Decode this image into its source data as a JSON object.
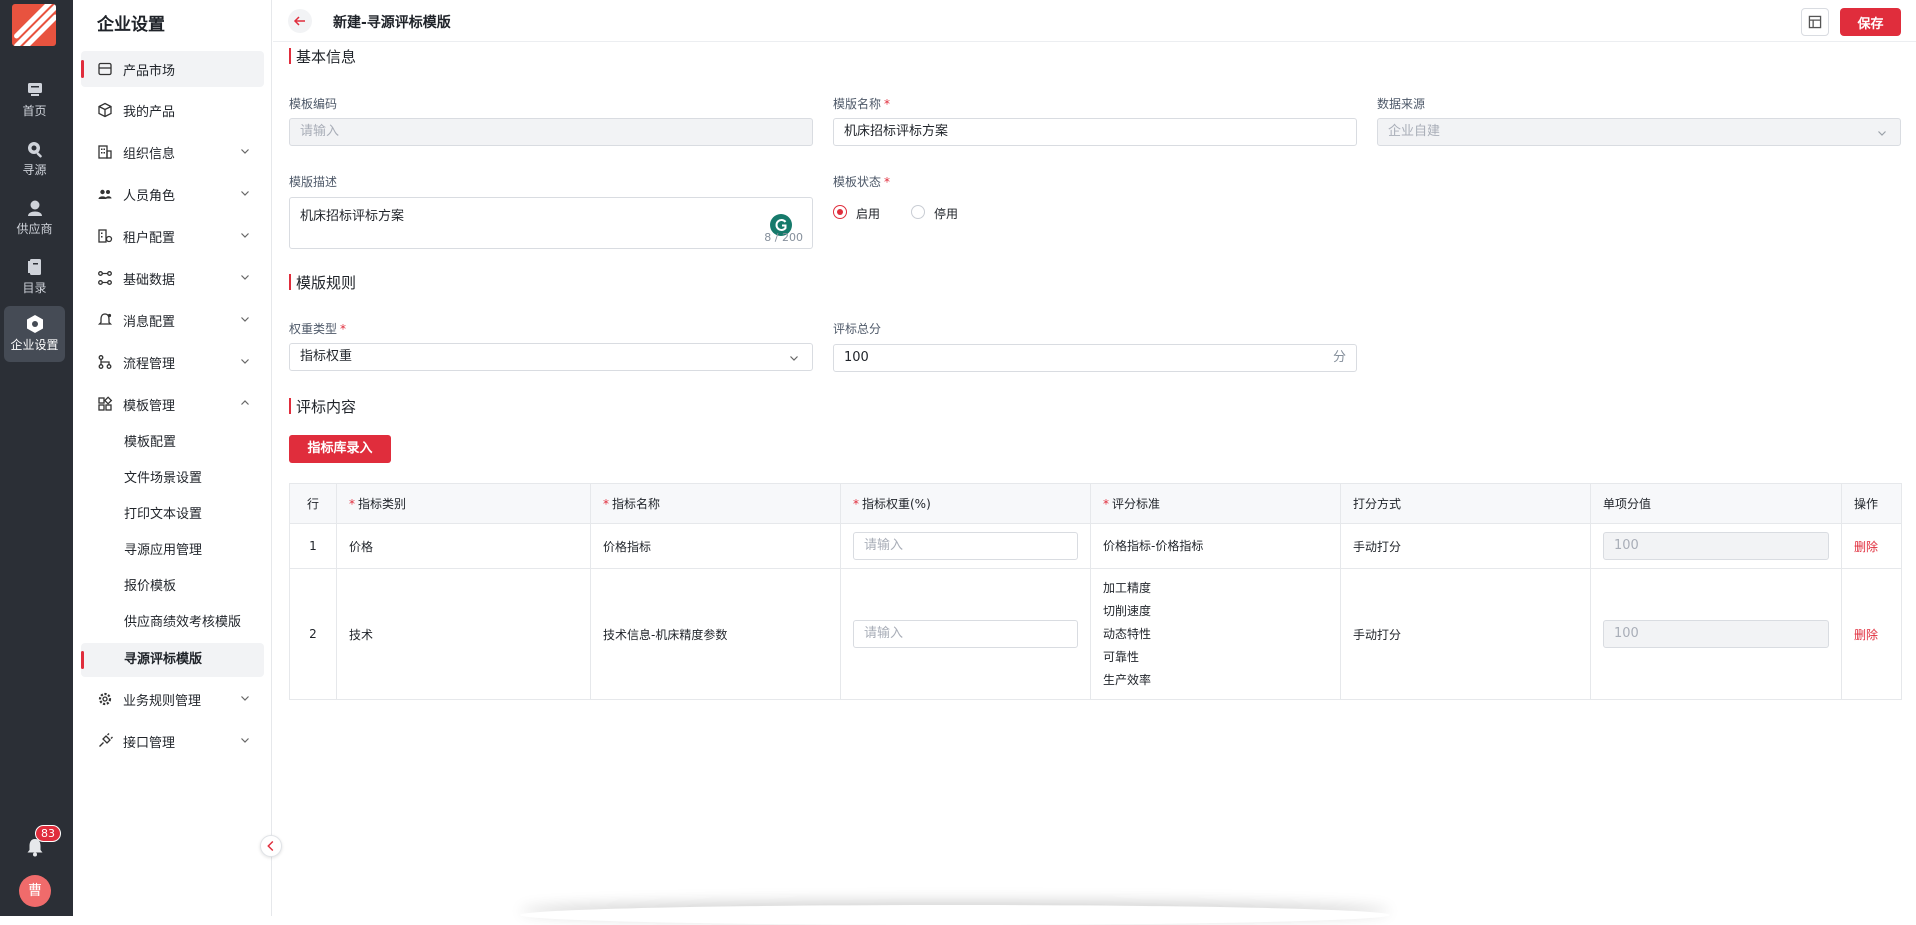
{
  "rail": {
    "items": [
      {
        "label": "首页",
        "icon": "home-icon"
      },
      {
        "label": "寻源",
        "icon": "sourcing-search-icon"
      },
      {
        "label": "供应商",
        "icon": "supplier-icon"
      },
      {
        "label": "目录",
        "icon": "catalog-icon"
      },
      {
        "label": "企业设置",
        "icon": "enterprise-settings-icon",
        "active": true
      }
    ],
    "notification_count": "83",
    "avatar_text": "曹"
  },
  "sidebar": {
    "title": "企业设置",
    "items": [
      {
        "label": "产品市场",
        "icon": "store-icon",
        "active": true
      },
      {
        "label": "我的产品",
        "icon": "cube-icon"
      },
      {
        "label": "组织信息",
        "icon": "building-icon",
        "expandable": true
      },
      {
        "label": "人员角色",
        "icon": "users-icon",
        "expandable": true
      },
      {
        "label": "租户配置",
        "icon": "tenant-icon",
        "expandable": true
      },
      {
        "label": "基础数据",
        "icon": "data-nodes-icon",
        "expandable": true
      },
      {
        "label": "消息配置",
        "icon": "message-bell-icon",
        "expandable": true
      },
      {
        "label": "流程管理",
        "icon": "flow-icon",
        "expandable": true
      },
      {
        "label": "模板管理",
        "icon": "template-grid-icon",
        "expanded": true
      }
    ],
    "sub_items": [
      {
        "label": "模板配置"
      },
      {
        "label": "文件场景设置"
      },
      {
        "label": "打印文本设置"
      },
      {
        "label": "寻源应用管理"
      },
      {
        "label": "报价模板"
      },
      {
        "label": "供应商绩效考核模版"
      },
      {
        "label": "寻源评标模版",
        "active": true
      }
    ],
    "items_after": [
      {
        "label": "业务规则管理",
        "icon": "gear-icon",
        "expandable": true
      },
      {
        "label": "接口管理",
        "icon": "plug-icon",
        "expandable": true
      }
    ]
  },
  "header": {
    "title": "新建-寻源评标模版",
    "save_label": "保存"
  },
  "basic_info": {
    "section_title": "基本信息",
    "code_label": "模板编码",
    "code_placeholder": "请输入",
    "name_label": "模版名称",
    "name_value": "机床招标评标方案",
    "source_label": "数据来源",
    "source_value": "企业自建",
    "desc_label": "模版描述",
    "desc_value": "机床招标评标方案",
    "desc_counter": "8 / 200",
    "status_label": "模板状态",
    "status_options": [
      "启用",
      "停用"
    ],
    "status_selected": "启用"
  },
  "rules": {
    "section_title": "模版规则",
    "weight_type_label": "权重类型",
    "weight_type_value": "指标权重",
    "total_score_label": "评标总分",
    "total_score_value": "100",
    "total_score_unit": "分"
  },
  "content": {
    "section_title": "评标内容",
    "import_button": "指标库录入",
    "columns": [
      "行",
      "指标类别",
      "指标名称",
      "指标权重(%)",
      "评分标准",
      "打分方式",
      "单项分值",
      "操作"
    ],
    "input_placeholder": "请输入",
    "rows": [
      {
        "row": "1",
        "category": "价格",
        "name": "价格指标",
        "criteria": [
          "价格指标-价格指标"
        ],
        "method": "手动打分",
        "score": "100",
        "action": "删除"
      },
      {
        "row": "2",
        "category": "技术",
        "name": "技术信息-机床精度参数",
        "criteria": [
          "加工精度",
          "切削速度",
          "动态特性",
          "可靠性",
          "生产效率"
        ],
        "method": "手动打分",
        "score": "100",
        "action": "删除"
      }
    ]
  },
  "colors": {
    "primary": "#e02d3c",
    "rail_bg": "#2b2f36",
    "logo": "#e8533f"
  }
}
